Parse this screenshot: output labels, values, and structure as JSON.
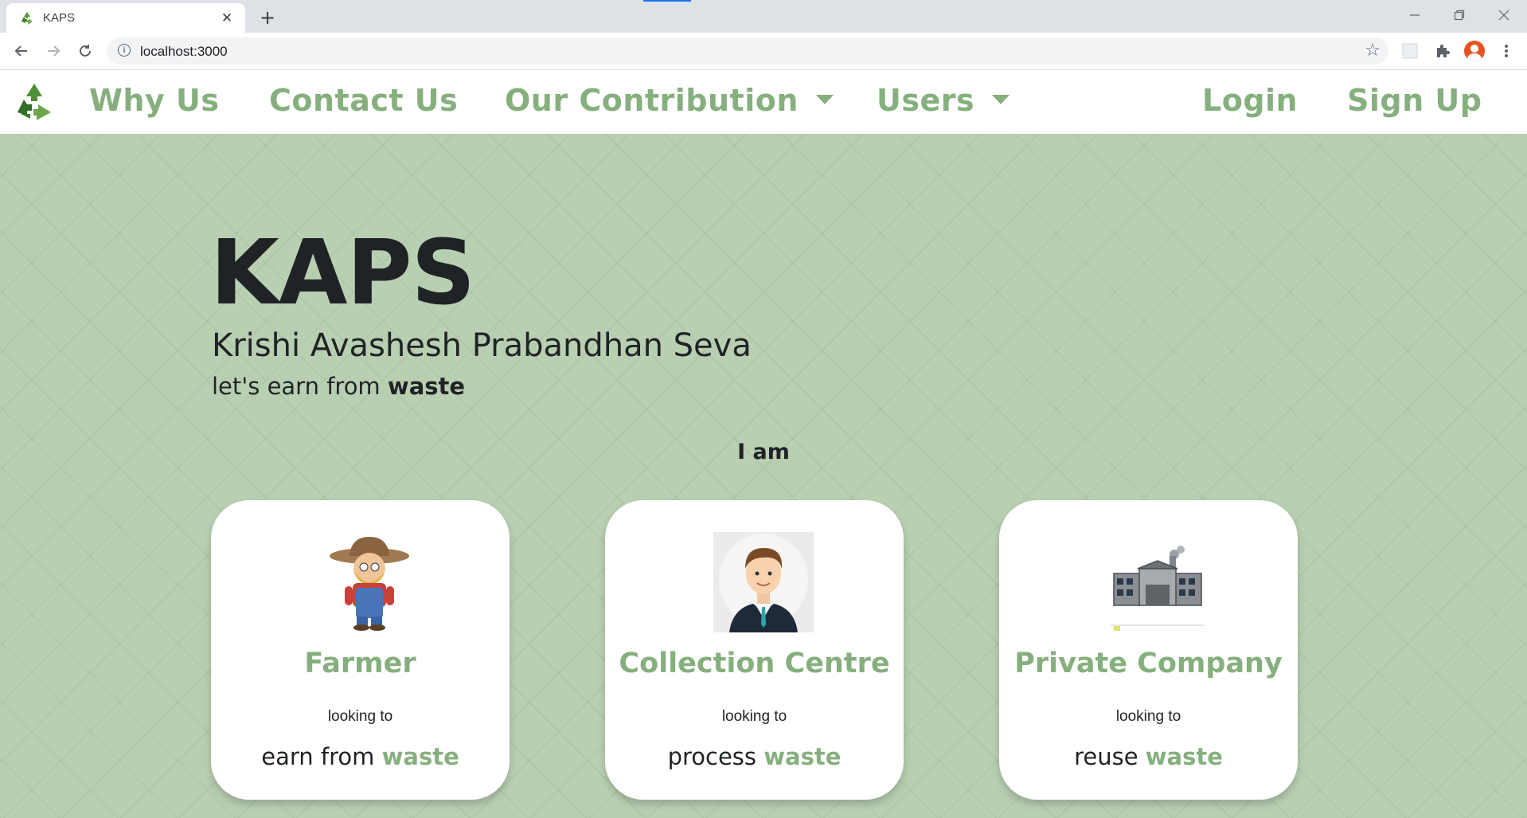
{
  "browser": {
    "tab_title": "KAPS",
    "new_tab_icon": "plus-icon",
    "url": "localhost:3000"
  },
  "nav": {
    "links": [
      "Why Us",
      "Contact Us",
      "Our Contribution",
      "Users"
    ],
    "login": "Login",
    "signup": "Sign Up"
  },
  "hero": {
    "title": "KAPS",
    "subtitle": "Krishi Avashesh Prabandhan Seva",
    "tagline_prefix": "let's earn from ",
    "tagline_bold": "waste",
    "prompt": "I am"
  },
  "cards": [
    {
      "title": "Farmer",
      "sub": "looking to",
      "cta_prefix": "earn from ",
      "cta_highlight": "waste",
      "icon": "farmer-avatar"
    },
    {
      "title": "Collection Centre",
      "sub": "looking to",
      "cta_prefix": "process ",
      "cta_highlight": "waste",
      "icon": "businessman-avatar"
    },
    {
      "title": "Private Company",
      "sub": "looking to",
      "cta_prefix": "reuse ",
      "cta_highlight": "waste",
      "icon": "factory-icon"
    }
  ],
  "colors": {
    "brand_green": "#86af7e",
    "hero_bg": "#b9cfb2",
    "text_dark": "#1f2326"
  }
}
